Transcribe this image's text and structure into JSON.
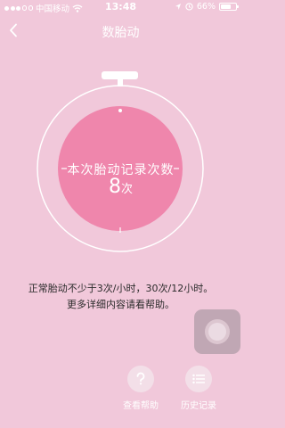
{
  "status_bar": {
    "carrier": "中国移动",
    "time": "13:48",
    "battery": "66%",
    "battery_level": 0.66,
    "icons": [
      "signal-icon",
      "wifi-icon",
      "location-icon",
      "alarm-icon",
      "battery-icon"
    ]
  },
  "nav": {
    "title": "数胎动",
    "back_icon": "chevron-left-icon"
  },
  "stopwatch": {
    "label": "本次胎动记录次数",
    "count": "8",
    "unit": "次",
    "colors": {
      "face": "#ef86ac",
      "ring": "#ffffff",
      "tick": "#ffffff"
    }
  },
  "info": {
    "line1": "正常胎动不少于3次/小时，30次/12小时。",
    "line2": "更多详细内容请看帮助。"
  },
  "bottom": {
    "help_label": "查看帮助",
    "history_label": "历史记录",
    "help_icon": "question-mark-icon",
    "history_icon": "list-icon"
  },
  "colors": {
    "background": "#f1c8da",
    "text_dark": "#2b2b2b",
    "floating_button": "#c0a7b4"
  }
}
